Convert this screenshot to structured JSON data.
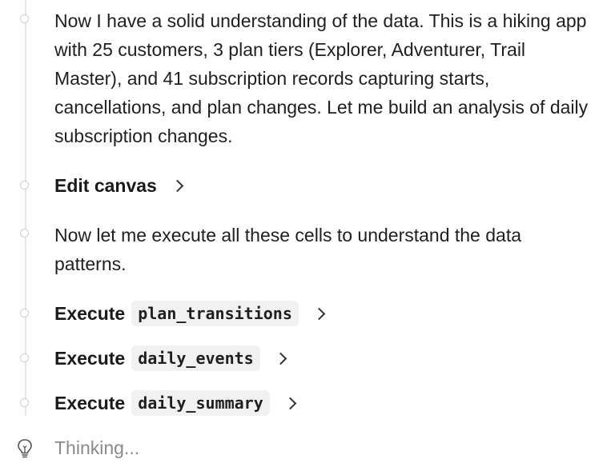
{
  "messages": [
    {
      "type": "text",
      "text": "Now I have a solid understanding of the data. This is a hiking app with 25 customers, 3 plan tiers (Explorer, Adventurer, Trail Master), and 41 subscription records capturing starts, cancellations, and plan changes. Let me build an analysis of daily subscription changes."
    },
    {
      "type": "action",
      "label": "Edit canvas"
    },
    {
      "type": "text",
      "text": "Now let me execute all these cells to understand the data patterns."
    },
    {
      "type": "action",
      "label": "Execute",
      "code": "plan_transitions"
    },
    {
      "type": "action",
      "label": "Execute",
      "code": "daily_events"
    },
    {
      "type": "action",
      "label": "Execute",
      "code": "daily_summary"
    }
  ],
  "status": {
    "text": "Thinking...",
    "icon": "lightbulb-icon"
  },
  "colors": {
    "text": "#1f1f1f",
    "muted": "#8a8a8a",
    "chip_bg": "#f1f1f1",
    "timeline": "#e6e6e6"
  }
}
